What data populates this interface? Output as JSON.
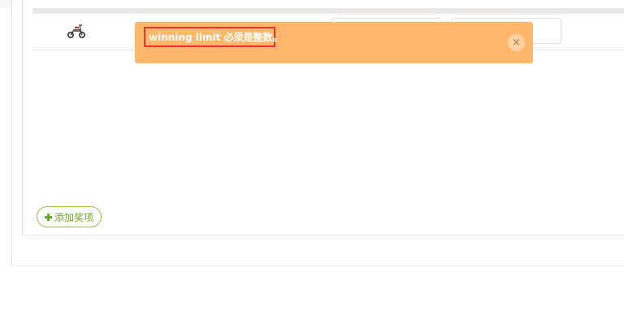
{
  "toast": {
    "message": "winning limit 必须是整数。",
    "close_glyph": "×",
    "bg_color": "#ffb86b",
    "highlight_color": "#e8352f"
  },
  "prize_table": {
    "row_image_icon": "scooter-icon",
    "inputs": [
      {
        "value": ""
      },
      {
        "value": ""
      }
    ]
  },
  "actions": {
    "add_prize_label": "添加奖项",
    "accent_color": "#8cc63f"
  }
}
